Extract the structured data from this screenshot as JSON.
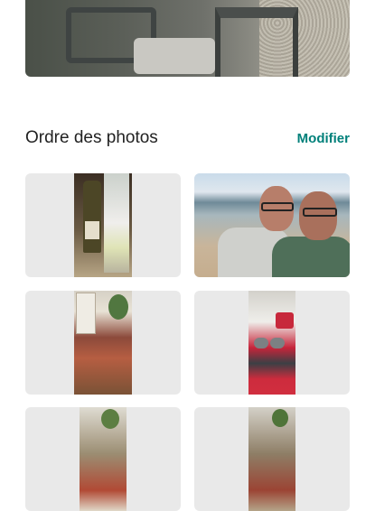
{
  "section": {
    "title": "Ordre des photos",
    "edit_label": "Modifier"
  },
  "colors": {
    "accent": "#00807a",
    "tile_background": "#e9e9e9",
    "title_text": "#222222"
  },
  "photos": [
    {
      "content": "wine bottle and glass"
    },
    {
      "content": "two men selfie on beach"
    },
    {
      "content": "living room table"
    },
    {
      "content": "bed with red blanket and towels"
    },
    {
      "content": "room with plant"
    },
    {
      "content": "room with plant"
    }
  ]
}
